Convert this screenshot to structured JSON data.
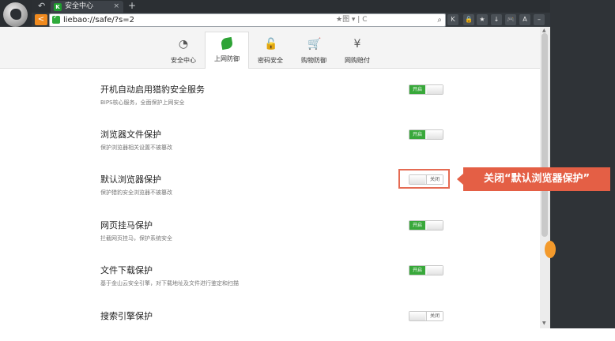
{
  "browser": {
    "tab_title": "安全中心",
    "tab_close": "×",
    "new_tab": "+",
    "url": "liebao://safe/?s=2",
    "address_tools": "★图 ▾ | C",
    "back_glyph": "<",
    "accent": "#f08a1e",
    "toolbar_icons": [
      "k-icon",
      "lock-icon",
      "star-icon",
      "download-icon",
      "gamepad-icon",
      "font-icon",
      "minus-icon"
    ],
    "toolbar_glyphs": [
      "K",
      "🔒",
      "★",
      "↓",
      "🎮",
      "A",
      "–"
    ]
  },
  "tabs": [
    {
      "label": "安全中心",
      "icon": "gauge-icon",
      "glyph": "◔",
      "active": false
    },
    {
      "label": "上网防御",
      "icon": "leaf-icon",
      "glyph": "",
      "active": true
    },
    {
      "label": "密码安全",
      "icon": "lock-icon",
      "glyph": "🔓",
      "active": false
    },
    {
      "label": "购物防御",
      "icon": "cart-icon",
      "glyph": "🛒",
      "active": false
    },
    {
      "label": "网购赔付",
      "icon": "money-hand-icon",
      "glyph": "¥",
      "active": false
    }
  ],
  "settings": [
    {
      "title": "开机自动启用猎豹安全服务",
      "desc": "BIPS核心服务，全面保护上网安全",
      "state_label": "开启",
      "on": true
    },
    {
      "title": "浏览器文件保护",
      "desc": "保护浏览器相关设置不被篡改",
      "state_label": "开启",
      "on": true
    },
    {
      "title": "默认浏览器保护",
      "desc": "保护猎豹安全浏览器不被篡改",
      "state_label": "关闭",
      "on": false
    },
    {
      "title": "网页挂马保护",
      "desc": "拦截网页挂马，保护系统安全",
      "state_label": "开启",
      "on": true
    },
    {
      "title": "文件下载保护",
      "desc": "基于金山云安全引擎，对下载地址及文件进行鉴定和扫描",
      "state_label": "开启",
      "on": true
    },
    {
      "title": "搜索引擎保护",
      "desc": "",
      "state_label": "关闭",
      "on": false
    }
  ],
  "callout": {
    "text": "关闭“默认浏览器保护”",
    "color": "#e45f45"
  },
  "colors": {
    "toggle_on": "#38a83a",
    "highlight": "#e56b53"
  }
}
